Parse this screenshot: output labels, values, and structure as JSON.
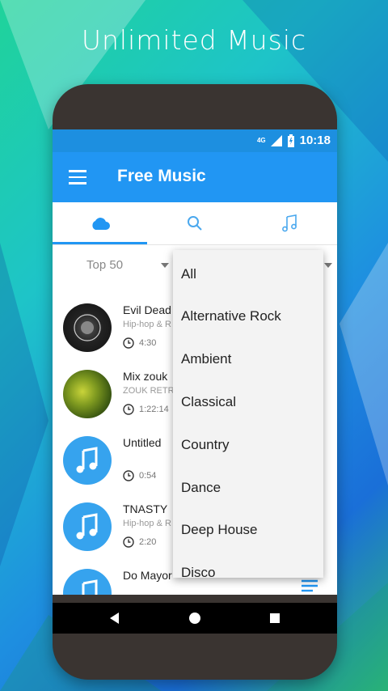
{
  "headline": "Unlimited Music",
  "status": {
    "network": "4G",
    "time": "10:18"
  },
  "app": {
    "title": "Free Music"
  },
  "tabs": [
    {
      "name": "cloud-icon",
      "active": true
    },
    {
      "name": "search-icon",
      "active": false
    },
    {
      "name": "music-library-icon",
      "active": false
    }
  ],
  "filter": {
    "chart_value": "Top 50"
  },
  "tracks": [
    {
      "title": "Evil Dead",
      "subtitle": "Hip-hop & R",
      "duration": "4:30",
      "avatar": "artwork"
    },
    {
      "title": "Mix zouk",
      "subtitle": "ZOUK RETR",
      "duration": "1:22:14",
      "avatar": "artwork"
    },
    {
      "title": "Untitled",
      "subtitle": "",
      "duration": "0:54",
      "avatar": "music-note-icon"
    },
    {
      "title": "TNASTY",
      "subtitle": "Hip-hop & R",
      "duration": "2:20",
      "avatar": "music-note-icon"
    },
    {
      "title": "Do Mayor",
      "subtitle": "",
      "duration": "",
      "avatar": "music-note-icon"
    }
  ],
  "genres": [
    "All",
    "Alternative Rock",
    "Ambient",
    "Classical",
    "Country",
    "Dance",
    "Deep House",
    "Disco"
  ],
  "colors": {
    "primary": "#2196f3",
    "status_bar": "#1d8fe0",
    "note_avatar": "#36a3ee"
  }
}
